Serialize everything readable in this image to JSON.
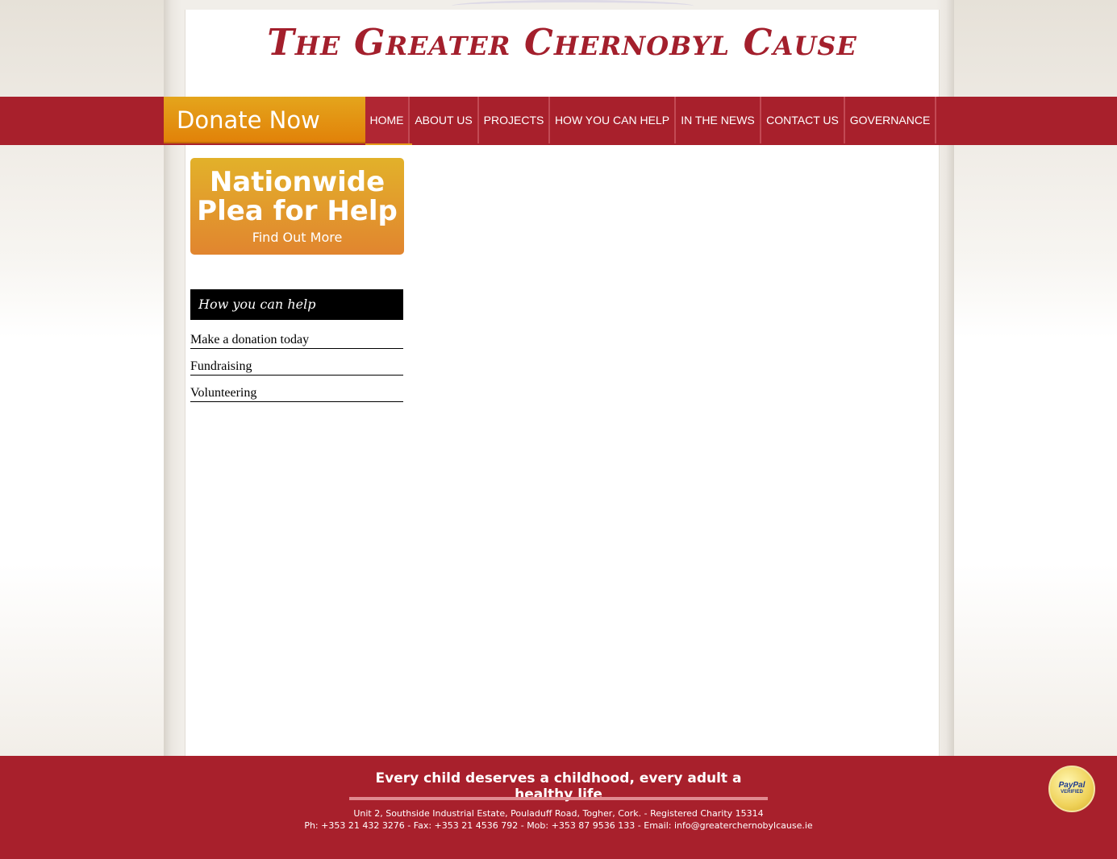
{
  "header": {
    "site_title": "The Greater Chernobyl Cause"
  },
  "nav": {
    "donate_label": "Donate Now",
    "items": [
      {
        "label": "HOME"
      },
      {
        "label": "ABOUT US"
      },
      {
        "label": "PROJECTS"
      },
      {
        "label": "HOW YOU CAN HELP"
      },
      {
        "label": "IN THE NEWS"
      },
      {
        "label": "CONTACT US"
      },
      {
        "label": "GOVERNANCE"
      }
    ]
  },
  "promo": {
    "line1": "Nationwide",
    "line2": "Plea for Help",
    "sub": "Find Out More"
  },
  "sidebar": {
    "heading": "How you can help",
    "links": [
      {
        "label": "Make a donation today"
      },
      {
        "label": "Fundraising"
      },
      {
        "label": "Volunteering"
      }
    ]
  },
  "footer": {
    "tagline": "Every child deserves a childhood, every adult a healthy life",
    "address": "Unit 2, Southside Industrial Estate, Pouladuff Road, Togher, Cork. - Registered Charity 15314",
    "contact": "Ph: +353 21 432 3276 - Fax: +353 21 4536 792 - Mob: +353 87 9536 133 - Email: info@greaterchernobylcause.ie",
    "paypal_name": "PayPal",
    "paypal_verified": "VERIFIED"
  },
  "colors": {
    "brand_red": "#a8202c",
    "donate_orange": "#e28209",
    "title_red": "#a31f2c"
  }
}
